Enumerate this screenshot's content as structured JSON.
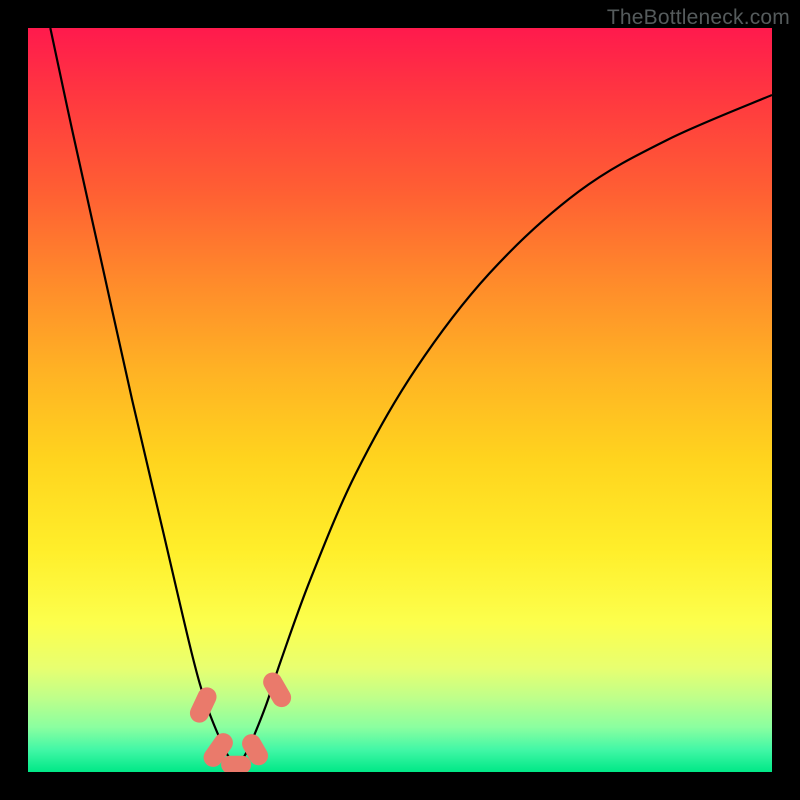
{
  "watermark": "TheBottleneck.com",
  "colors": {
    "frame": "#000000",
    "curve": "#000000",
    "marker": "#ea7a6b",
    "gradient_top": "#ff1a4d",
    "gradient_bottom": "#00e887"
  },
  "chart_data": {
    "type": "line",
    "title": "",
    "xlabel": "",
    "ylabel": "",
    "xlim": [
      0,
      100
    ],
    "ylim": [
      0,
      100
    ],
    "note": "V-shaped bottleneck curve; y=0 is the bottom (optimal/green), y=100 is the top (worst/red). Values read from figure; curve minimum near x≈28.",
    "series": [
      {
        "name": "bottleneck-curve",
        "x": [
          3,
          6,
          10,
          14,
          18,
          22,
          24,
          26,
          27,
          28,
          29,
          30,
          32,
          34,
          38,
          44,
          52,
          62,
          74,
          86,
          100
        ],
        "y": [
          100,
          86,
          68,
          50,
          33,
          16,
          9,
          4,
          2,
          1,
          2,
          4,
          9,
          15,
          26,
          40,
          54,
          67,
          78,
          85,
          91
        ]
      }
    ],
    "markers": [
      {
        "x": 23.5,
        "y": 9,
        "w": 2.5,
        "h": 5,
        "rot": 25
      },
      {
        "x": 25.5,
        "y": 3,
        "w": 2.5,
        "h": 5,
        "rot": 35
      },
      {
        "x": 28,
        "y": 1,
        "w": 4,
        "h": 2.5,
        "rot": 0
      },
      {
        "x": 30.5,
        "y": 3,
        "w": 2.5,
        "h": 4.5,
        "rot": -30
      },
      {
        "x": 33.5,
        "y": 11,
        "w": 2.5,
        "h": 5,
        "rot": -30
      }
    ]
  }
}
